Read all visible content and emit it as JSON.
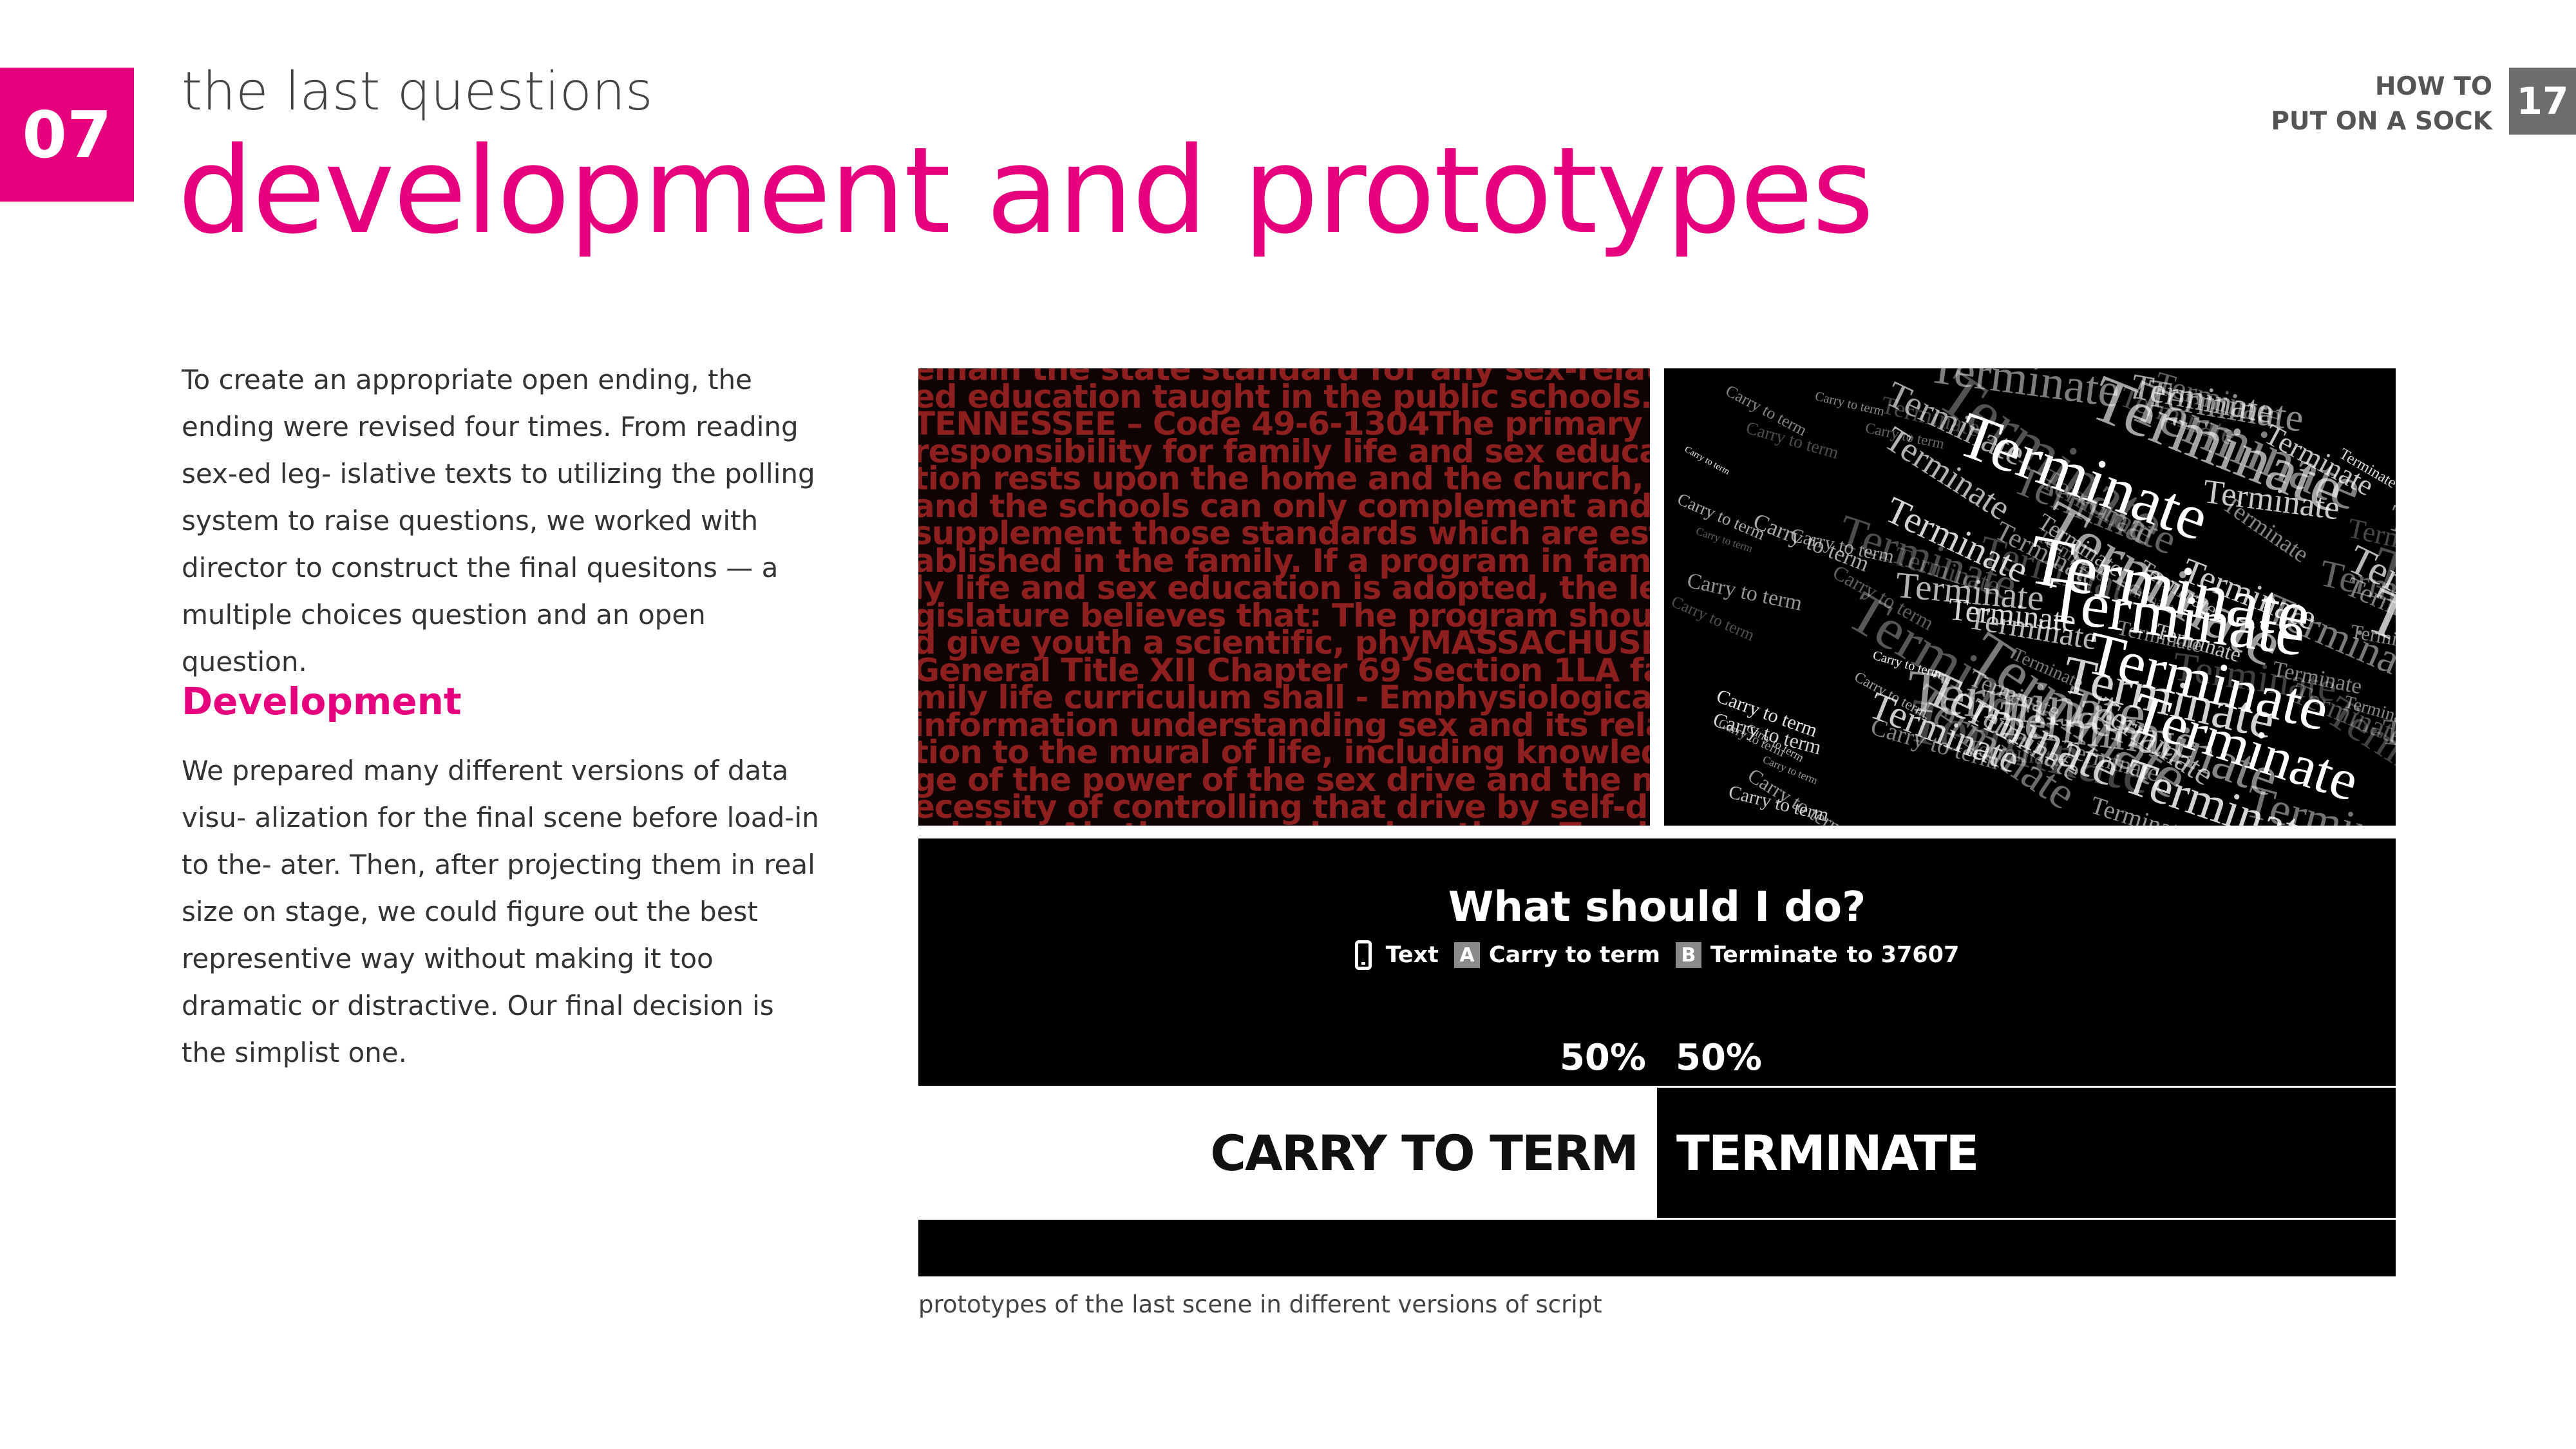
{
  "header": {
    "chapter_number": "07",
    "kicker": "the last questions",
    "title": "development and prototypes",
    "book_title_line1": "HOW TO",
    "book_title_line2": "PUT ON A SOCK",
    "page_number": "17"
  },
  "colors": {
    "accent": "#e6007e",
    "page_number_bg": "#6d6d6d"
  },
  "body": {
    "intro": "To create an appropriate open ending, the ending were revised four times. From reading sex-ed leg- islative texts to utilizing the polling system to raise questions, we worked with director to construct the final quesitons — a multiple choices question and an open question.",
    "subheading": "Development",
    "development": "We prepared many different versions of data visu- alization for the final scene before load-in to the- ater. Then, after projecting them in real size on stage, we could figure out the best representive way without making it too dramatic or distractive. Our final decision is the simplist one."
  },
  "prototype_red": {
    "text": "emain the state standard for any sex-related education taught in the public schools. TENNESSEE – Code 49-6-1304The primary responsibility for family life and sex education rests upon the home and the church, and the schools can only complement and supplement those standards which are established in the family. If a program in family life and sex education is adopted, the legislature believes that: The program should give youth a scientific, phyMASSACHUSE General Title XII Chapter 69 Section 1LA family life curriculum shall - Emphysiological information understanding sex and its relation to the mural of life, including knowledge of the power of the sex drive and the necessity of controlling that drive by self-discipline Abstinence-only education - Teaches the social, psychological and health gains to be realized by abstaining ARIZONA – Administrative Code R7-2-303Sex education shall not include the teaching of"
  },
  "prototype_black": {
    "word_terminate": "Terminate",
    "word_carry": "Carry to term"
  },
  "poll": {
    "question": "What should I do?",
    "text_label": "Text",
    "key_a": "A",
    "option_a": "Carry to term",
    "key_b": "B",
    "option_b": "Terminate",
    "to_number": "to 37607",
    "percent_a": "50%",
    "percent_b": "50%",
    "share_a": 0.5,
    "share_b": 0.5,
    "bar_label_a": "CARRY TO TERM",
    "bar_label_b": "TERMINATE"
  },
  "caption": "prototypes of the last scene in different versions of script"
}
